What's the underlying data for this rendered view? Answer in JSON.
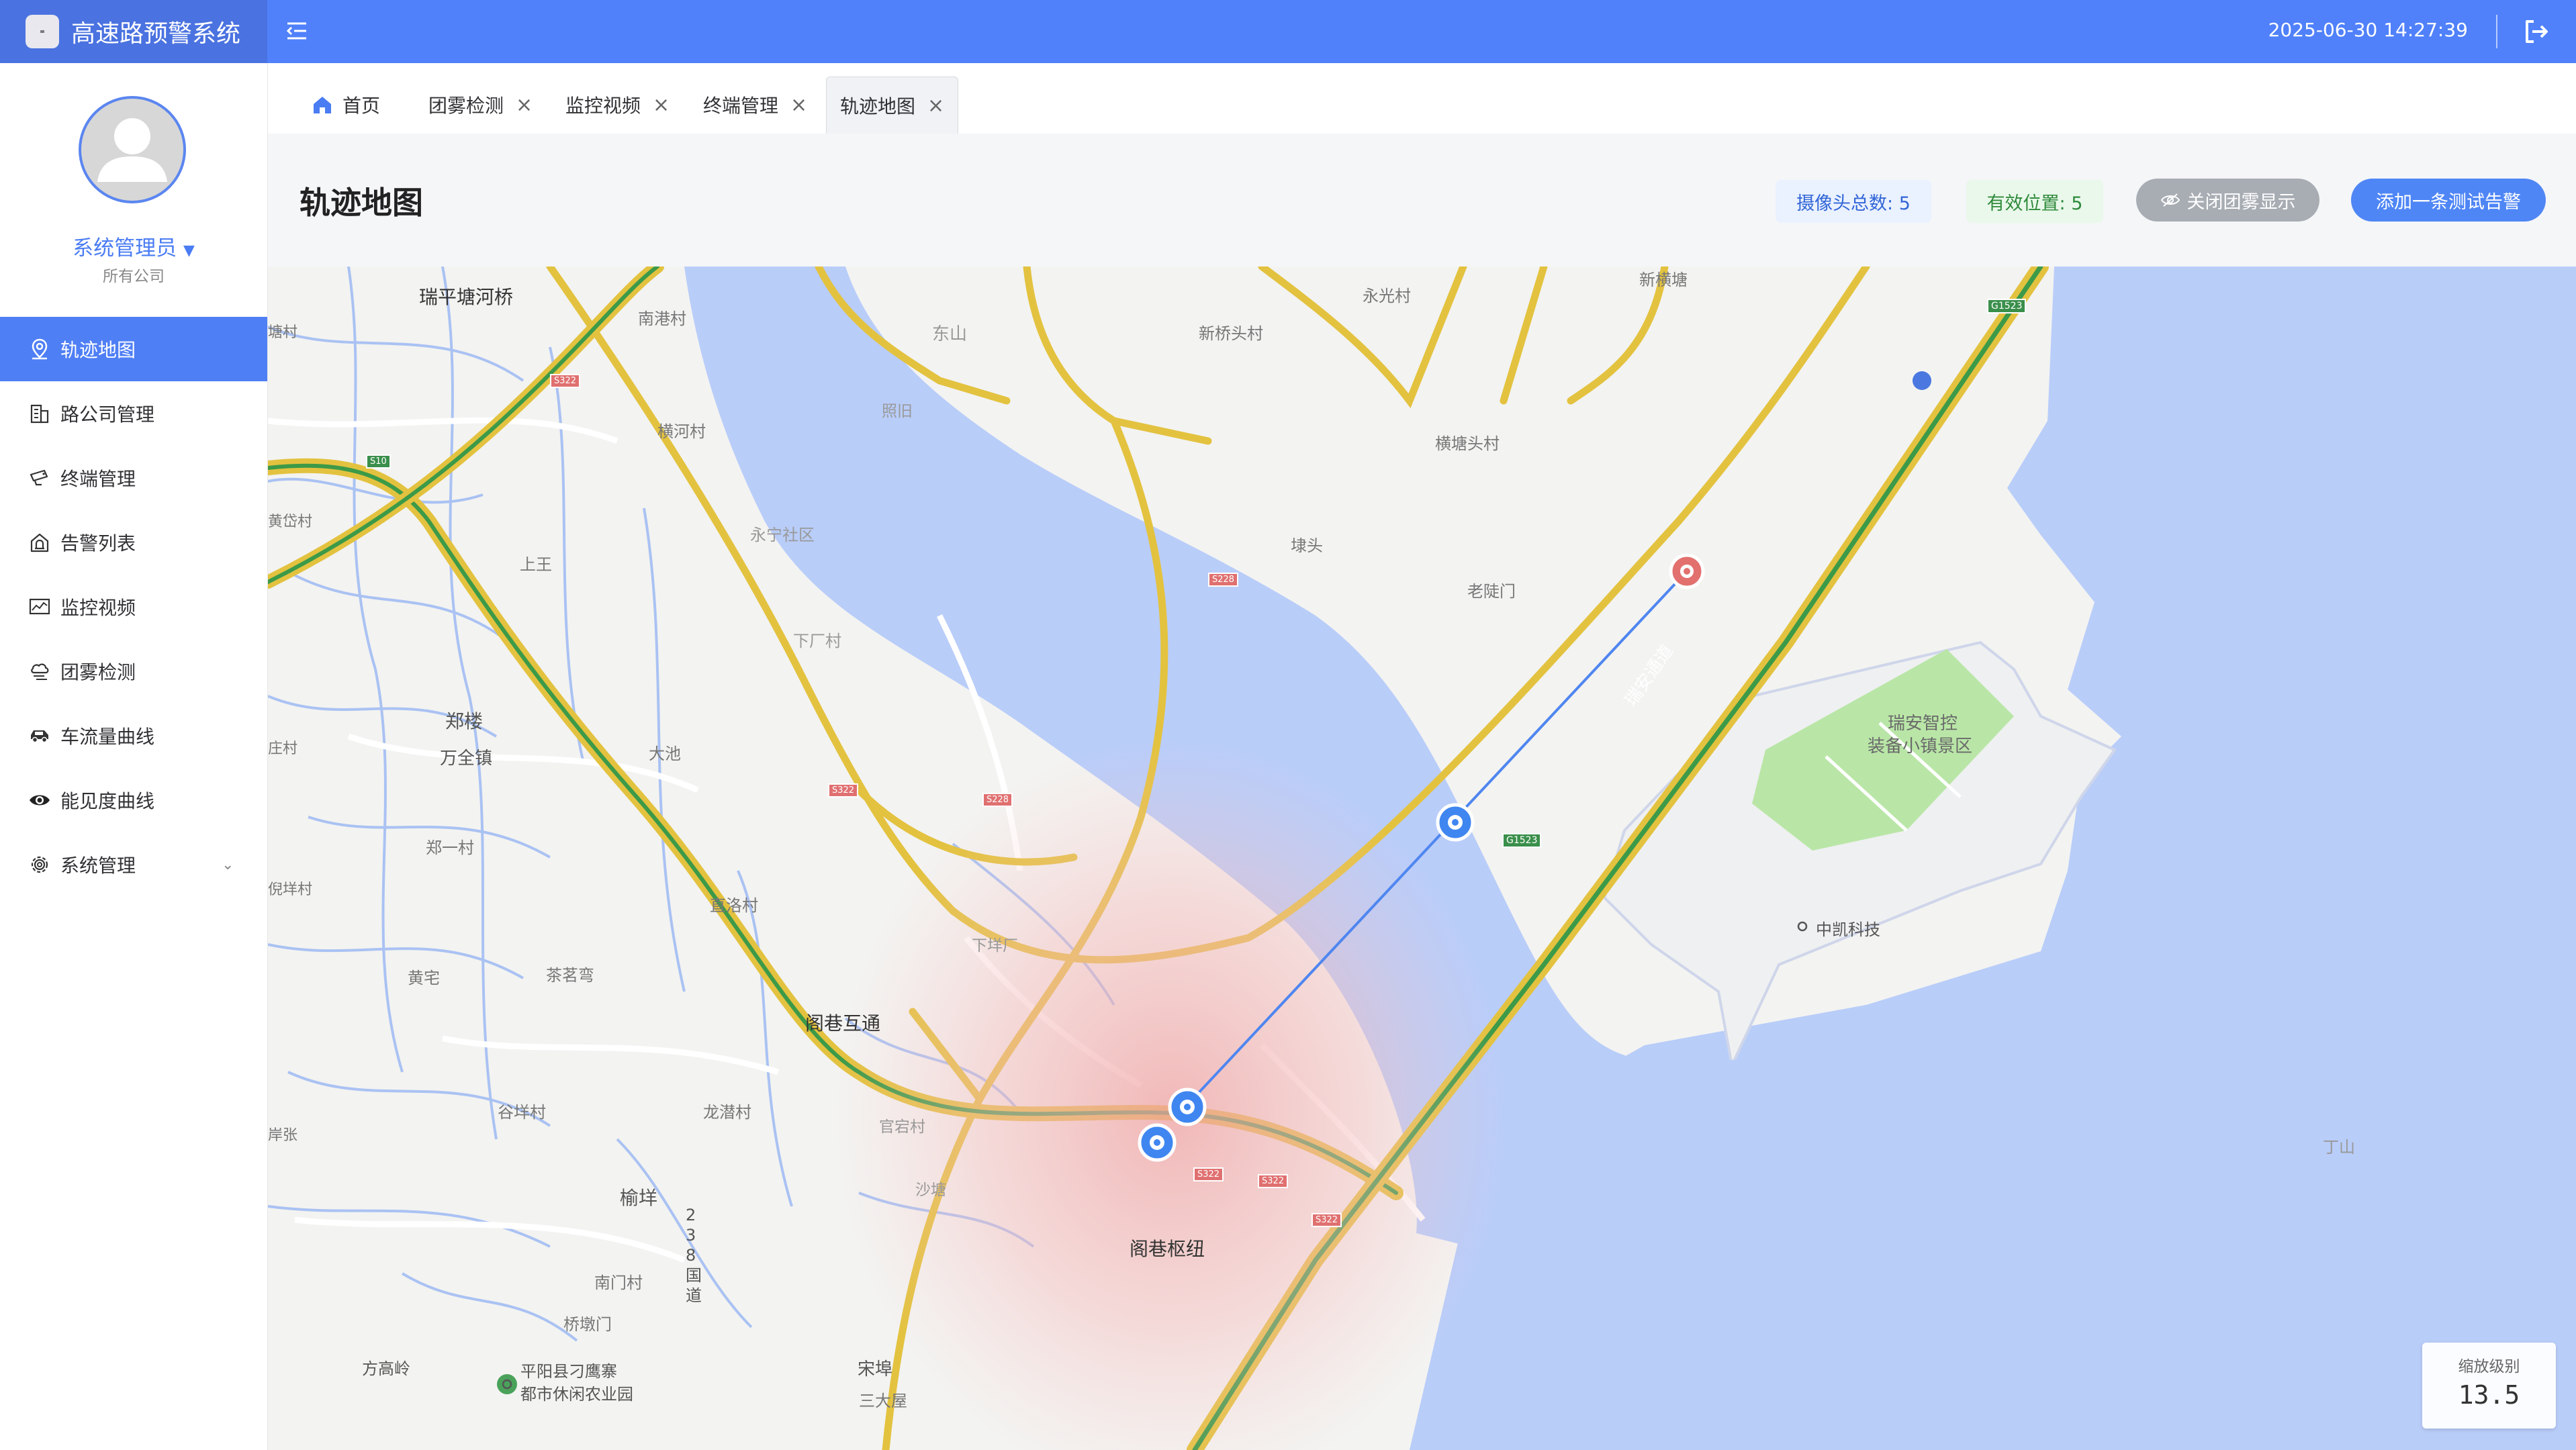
{
  "app": {
    "title": "高速路预警系统",
    "datetime": "2025-06-30 14:27:39"
  },
  "user": {
    "name": "系统管理员",
    "company": "所有公司"
  },
  "sidebar": {
    "items": [
      {
        "label": "轨迹地图",
        "icon": "location-pin-icon",
        "active": true
      },
      {
        "label": "路公司管理",
        "icon": "building-icon"
      },
      {
        "label": "终端管理",
        "icon": "camera-icon"
      },
      {
        "label": "告警列表",
        "icon": "alarm-house-icon"
      },
      {
        "label": "监控视频",
        "icon": "chart-monitor-icon"
      },
      {
        "label": "团雾检测",
        "icon": "fog-cloud-icon"
      },
      {
        "label": "车流量曲线",
        "icon": "car-icon"
      },
      {
        "label": "能见度曲线",
        "icon": "eye-icon"
      },
      {
        "label": "系统管理",
        "icon": "gear-icon"
      }
    ]
  },
  "tabs": [
    {
      "label": "首页",
      "closable": false
    },
    {
      "label": "团雾检测",
      "closable": true
    },
    {
      "label": "监控视频",
      "closable": true
    },
    {
      "label": "终端管理",
      "closable": true
    },
    {
      "label": "轨迹地图",
      "closable": true,
      "active": true
    }
  ],
  "page": {
    "title": "轨迹地图",
    "camera_total": "摄像头总数: 5",
    "valid_positions": "有效位置: 5",
    "fog_toggle_label": "关闭团雾显示",
    "add_alarm_label": "添加一条测试告警"
  },
  "map": {
    "zoom_label": "缩放级别",
    "zoom_value": "13.5",
    "place_labels": [
      "瑞平塘河桥",
      "南港村",
      "东山",
      "新桥头村",
      "永光村",
      "新横塘",
      "照旧",
      "横河村",
      "横塘头村",
      "永宁社区",
      "上王",
      "埭头",
      "老陡门",
      "下厂村",
      "郑楼",
      "万全镇",
      "大池",
      "瑞安智控",
      "装备小镇景区",
      "郑一村",
      "直洛村",
      "中凯科技",
      "下垟厂",
      "黄宅",
      "茶茗弯",
      "阁巷互通",
      "谷垟村",
      "龙潜村",
      "官宕村",
      "榆垟",
      "沙塘",
      "阁巷枢纽",
      "丁山",
      "南门村",
      "桥墩门",
      "方高岭",
      "平阳县刁鹰寨",
      "都市休闲农业园",
      "宋埠",
      "三大屋",
      "瑞安通道",
      "倪垟村",
      "岸张",
      "塘村",
      "黄岱村",
      "庄村",
      "2 3 8 国 道"
    ],
    "road_shields": [
      "G1523",
      "G1523",
      "S322",
      "S10",
      "S228",
      "S228",
      "S322",
      "S322",
      "S322",
      "S322"
    ],
    "colors": {
      "water": "#b9cdf9",
      "road": "#e3c23f",
      "expressway": "#3c9a48",
      "marker": "#3f86f0",
      "alarm": "#e2706e"
    }
  }
}
